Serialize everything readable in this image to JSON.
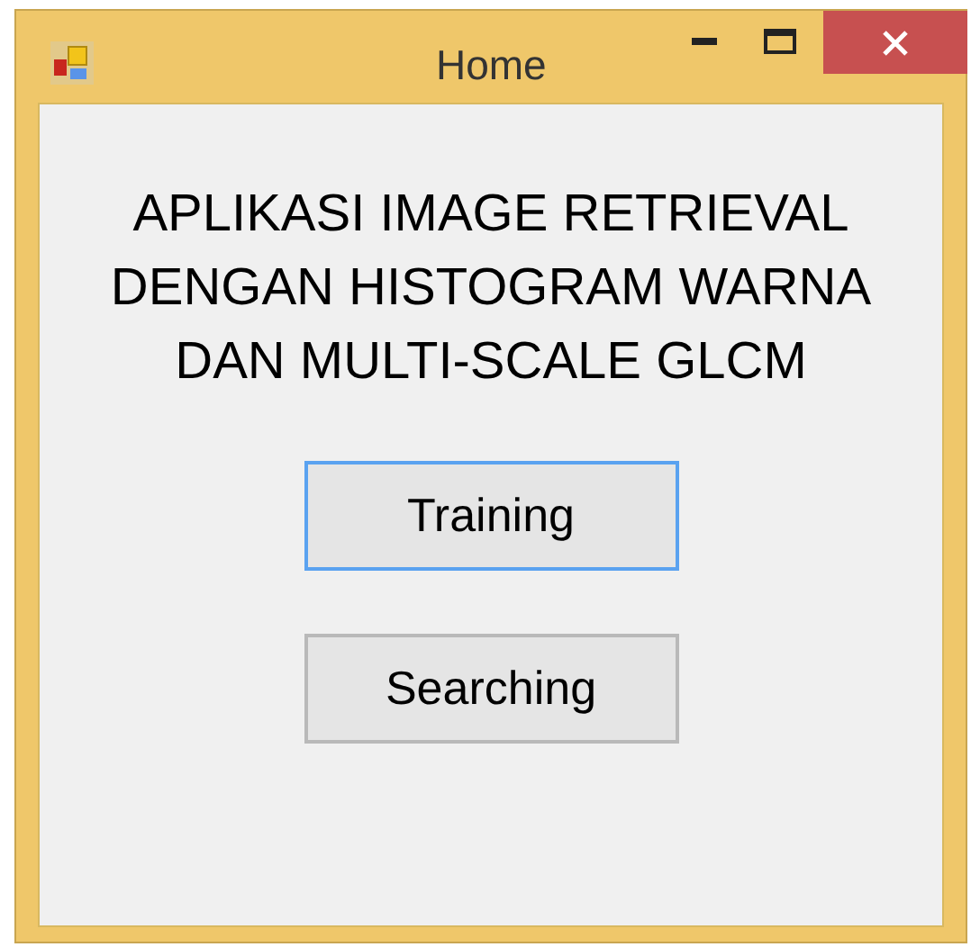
{
  "window": {
    "title": "Home"
  },
  "heading": "APLIKASI IMAGE RETRIEVAL DENGAN HISTOGRAM WARNA DAN MULTI-SCALE GLCM",
  "buttons": [
    {
      "label": "Training",
      "focused": true
    },
    {
      "label": "Searching",
      "focused": false
    }
  ]
}
